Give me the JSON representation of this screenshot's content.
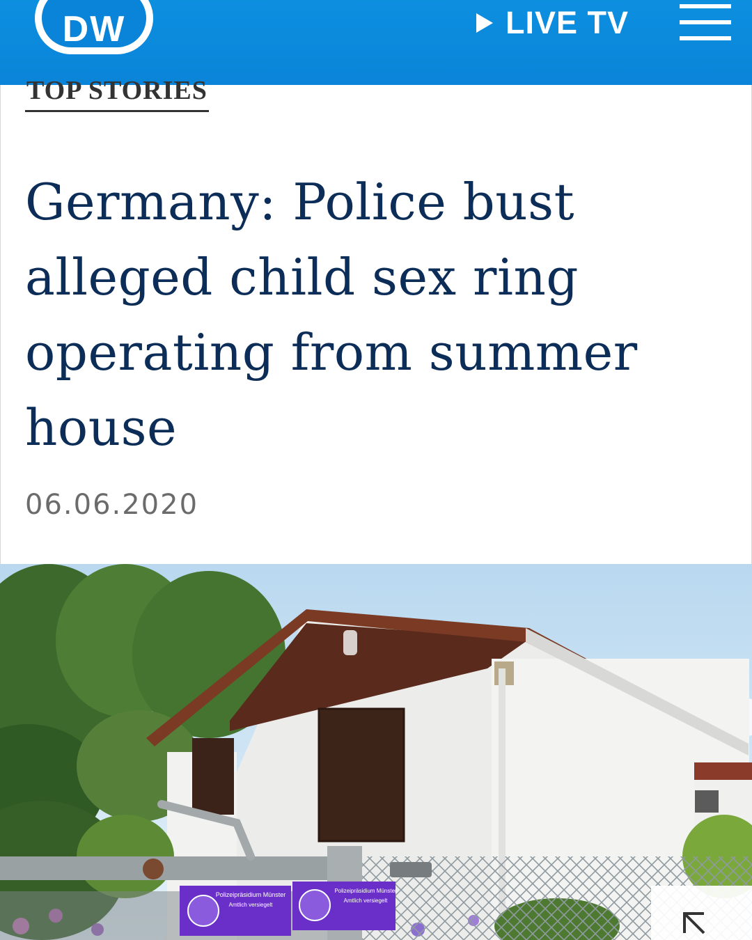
{
  "header": {
    "logo_text": "DW",
    "live_tv_label": "LIVE TV",
    "brand_color": "#0a84d8"
  },
  "article": {
    "section_label": "TOP STORIES",
    "headline": "Germany: Police bust alleged child sex ring operating from summer house",
    "date": "06.06.2020"
  },
  "photo": {
    "seal_left_title": "Polizeipräsidium Münster",
    "seal_left_status": "Amtlich versiegelt",
    "seal_right_title": "Polizeipräsidium Münster",
    "seal_right_status": "Amtlich versiegelt"
  },
  "icons": {
    "menu": "hamburger-menu-icon",
    "live": "play-icon",
    "expand": "expand-arrow-icon"
  },
  "colors": {
    "headline": "#0c2d57",
    "date": "#6b6b6b",
    "seal": "#6a2fc8"
  }
}
